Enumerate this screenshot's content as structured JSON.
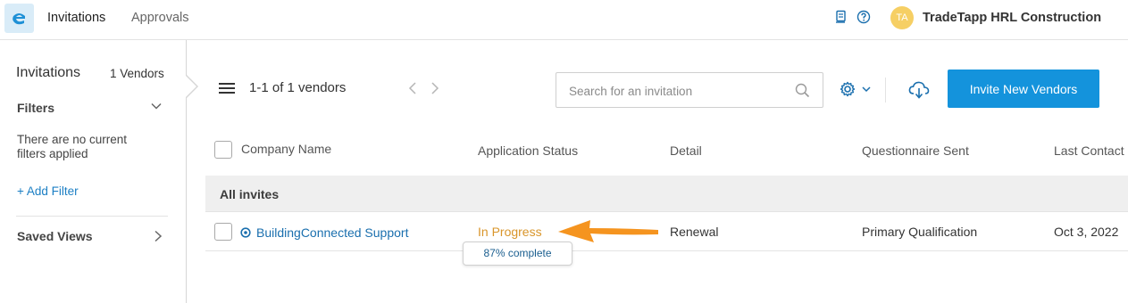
{
  "topbar": {
    "nav": [
      "Invitations",
      "Approvals"
    ],
    "avatar_initials": "TA",
    "company_name": "TradeTapp HRL Construction",
    "icons": [
      "app-logo-icon",
      "document-icon",
      "help-icon"
    ]
  },
  "sidebar": {
    "title": "Invitations",
    "vendor_count": "1 Vendors",
    "filters_label": "Filters",
    "no_filters_text": "There are no current filters applied",
    "add_filter_label": "+ Add Filter",
    "saved_views_label": "Saved Views"
  },
  "toolbar": {
    "page_count": "1-1 of 1 vendors",
    "search_placeholder": "Search for an invitation",
    "invite_button_label": "Invite New Vendors"
  },
  "table": {
    "columns": [
      "Company Name",
      "Application Status",
      "Detail",
      "Questionnaire Sent",
      "Last Contact"
    ],
    "group_label": "All invites",
    "rows": [
      {
        "company": "BuildingConnected Support",
        "status": "In Progress",
        "progress_label": "87% complete",
        "detail": "Renewal",
        "questionnaire": "Primary Qualification",
        "last_contact": "Oct 3, 2022"
      }
    ]
  },
  "colors": {
    "accent": "#1493dc",
    "link": "#1a6fae",
    "status_in_progress": "#d9952a",
    "annotation_arrow": "#f5941f",
    "avatar": "#f6cf64"
  }
}
